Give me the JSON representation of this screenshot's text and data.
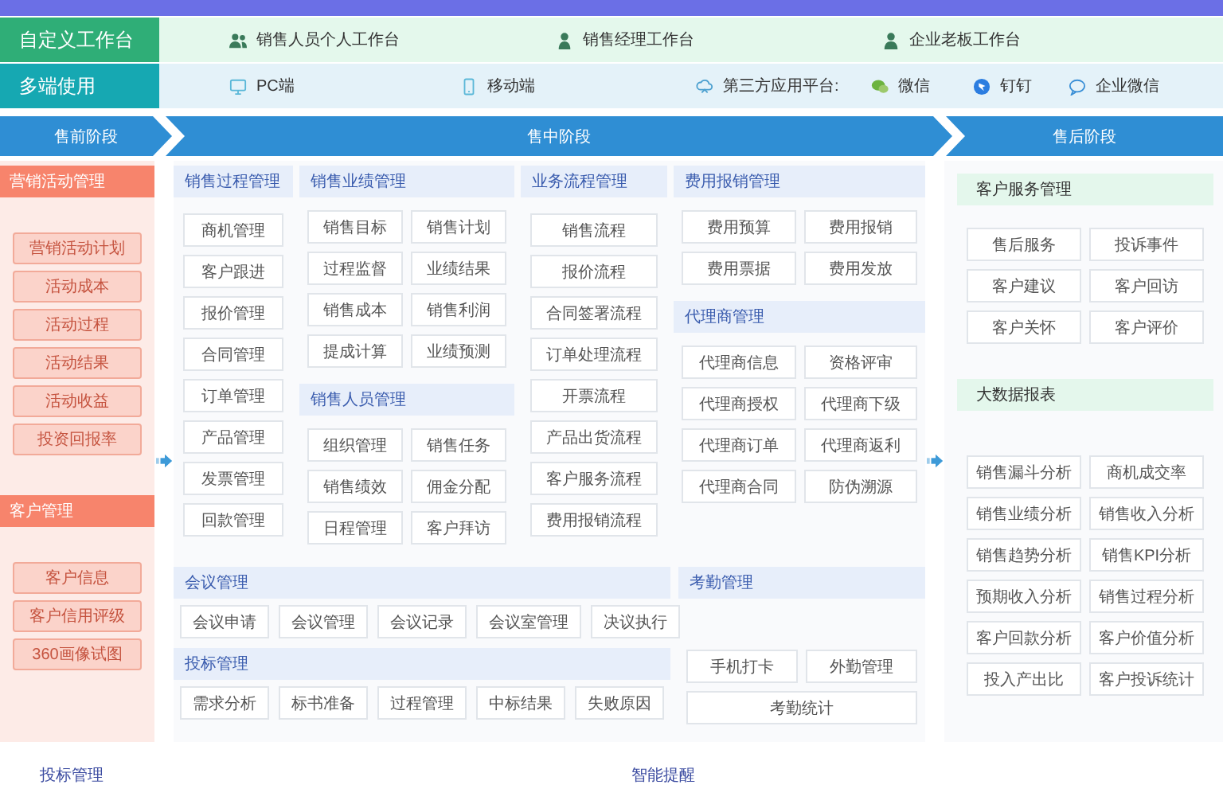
{
  "workbench": {
    "label": "自定义工作台",
    "items": [
      "销售人员个人工作台",
      "销售经理工作台",
      "企业老板工作台"
    ]
  },
  "platforms": {
    "label": "多端使用",
    "items": [
      "PC端",
      "移动端",
      "第三方应用平台:",
      "微信",
      "钉钉",
      "企业微信"
    ]
  },
  "stages": [
    "售前阶段",
    "售中阶段",
    "售后阶段"
  ],
  "presale": [
    {
      "title": "营销活动管理",
      "items": [
        "营销活动计划",
        "活动成本",
        "活动过程",
        "活动结果",
        "活动收益",
        "投资回报率"
      ]
    },
    {
      "title": "客户管理",
      "items": [
        "客户信息",
        "客户信用评级",
        "360画像试图"
      ]
    }
  ],
  "midsale_columns": [
    [
      {
        "title": "销售过程管理",
        "items": [
          "商机管理",
          "客户跟进",
          "报价管理",
          "合同管理",
          "订单管理",
          "产品管理",
          "发票管理",
          "回款管理"
        ]
      }
    ],
    [
      {
        "title": "销售业绩管理",
        "items": [
          "销售目标",
          "销售计划",
          "过程监督",
          "业绩结果",
          "销售成本",
          "销售利润",
          "提成计算",
          "业绩预测"
        ]
      },
      {
        "title": "销售人员管理",
        "items": [
          "组织管理",
          "销售任务",
          "销售绩效",
          "佣金分配",
          "日程管理",
          "客户拜访"
        ]
      }
    ],
    [
      {
        "title": "业务流程管理",
        "items": [
          "销售流程",
          "报价流程",
          "合同签署流程",
          "订单处理流程",
          "开票流程",
          "产品出货流程",
          "客户服务流程",
          "费用报销流程"
        ]
      }
    ],
    [
      {
        "title": "费用报销管理",
        "items": [
          "费用预算",
          "费用报销",
          "费用票据",
          "费用发放"
        ]
      },
      {
        "title": "代理商管理",
        "items": [
          "代理商信息",
          "资格评审",
          "代理商授权",
          "代理商下级",
          "代理商订单",
          "代理商返利",
          "代理商合同",
          "防伪溯源"
        ]
      }
    ]
  ],
  "midsale_rows": [
    {
      "title": "会议管理",
      "items": [
        "会议申请",
        "会议管理",
        "会议记录",
        "会议室管理",
        "决议执行"
      ]
    },
    {
      "title": "投标管理",
      "items": [
        "需求分析",
        "标书准备",
        "过程管理",
        "中标结果",
        "失败原因"
      ]
    }
  ],
  "attendance": {
    "title": "考勤管理",
    "items": [
      "手机打卡",
      "外勤管理",
      "考勤统计"
    ]
  },
  "postsale": [
    {
      "title": "客户服务管理",
      "items": [
        "售后服务",
        "投诉事件",
        "客户建议",
        "客户回访",
        "客户关怀",
        "客户评价"
      ]
    },
    {
      "title": "大数据报表",
      "items": [
        "销售漏斗分析",
        "商机成交率",
        "销售业绩分析",
        "销售收入分析",
        "销售趋势分析",
        "销售KPI分析",
        "预期收入分析",
        "销售过程分析",
        "客户回款分析",
        "客户价值分析",
        "投入产出比",
        "客户投诉统计"
      ]
    }
  ],
  "bottom_sections": [
    {
      "title": "投标管理"
    },
    {
      "title": "智能提醒"
    }
  ]
}
